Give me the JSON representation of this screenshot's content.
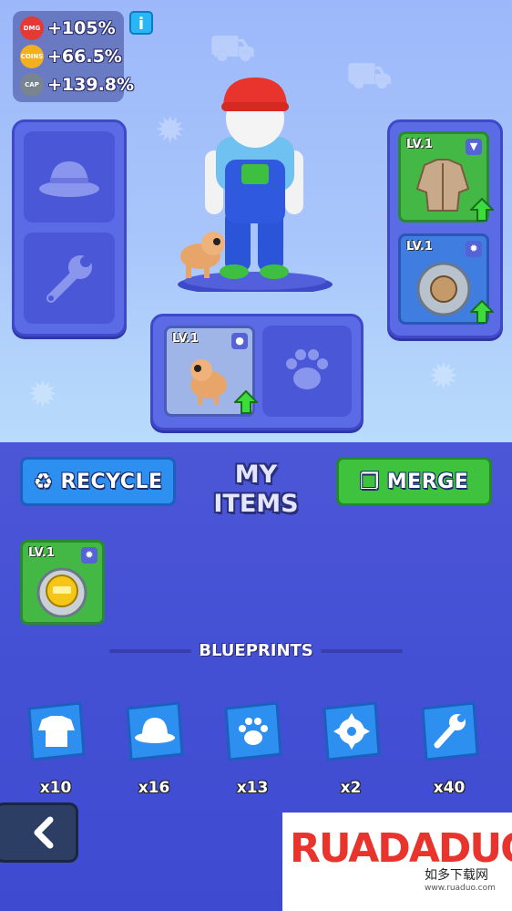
{
  "stats": [
    {
      "label": "DMG",
      "value": "+105%",
      "color": "#e53935"
    },
    {
      "label": "COINS",
      "value": "+66.5%",
      "color": "#f2b01e"
    },
    {
      "label": "CAP",
      "value": "+139.8%",
      "color": "#78848f"
    }
  ],
  "info_label": "i",
  "equipment_left": [
    {
      "slot": "hat",
      "icon": "hat-icon"
    },
    {
      "slot": "weapon",
      "icon": "wrench-icon"
    }
  ],
  "equipment_right": [
    {
      "level": "LV.1",
      "type_icon": "shirt-icon",
      "item": "jacket",
      "rarity": "green",
      "upgrade": true
    },
    {
      "level": "LV.1",
      "type_icon": "gear-icon",
      "item": "saw-shield",
      "rarity": "blue",
      "upgrade": true
    }
  ],
  "pet_slots": [
    {
      "level": "LV.1",
      "type_icon": "paw-icon",
      "item": "cat",
      "upgrade": true
    },
    {
      "empty": true,
      "icon": "paw-icon"
    }
  ],
  "buttons": {
    "recycle": "RECYCLE",
    "merge": "MERGE"
  },
  "title_line1": "MY",
  "title_line2": "ITEMS",
  "inventory": [
    {
      "level": "LV.1",
      "type_icon": "gear-icon",
      "item": "coin-saw",
      "rarity": "green"
    }
  ],
  "blueprints_label": "BLUEPRINTS",
  "blueprints": [
    {
      "icon": "shirt-icon",
      "count": "x10"
    },
    {
      "icon": "hat-icon",
      "count": "x16"
    },
    {
      "icon": "paw-icon",
      "count": "x13"
    },
    {
      "icon": "gear-icon",
      "count": "x2"
    },
    {
      "icon": "wrench-icon",
      "count": "x40"
    }
  ],
  "watermark": {
    "brand": "RUADADUO",
    "chinese": "如多下载网",
    "url": "www.ruaduo.com"
  },
  "colors": {
    "green_card": "#44b845",
    "blue_card": "#3f7ee0",
    "merge": "#3fc33e",
    "recycle": "#2d8ff0"
  }
}
